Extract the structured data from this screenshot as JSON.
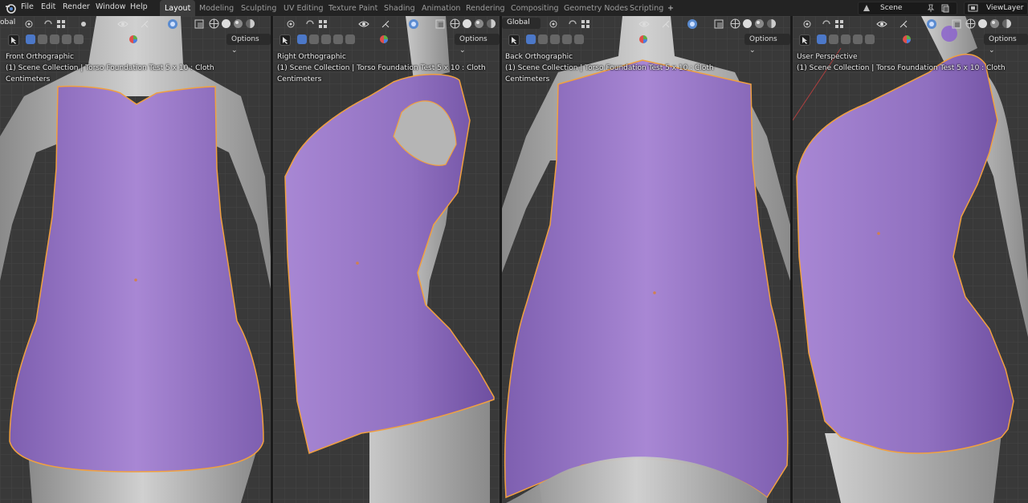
{
  "menu": {
    "file": "File",
    "edit": "Edit",
    "render": "Render",
    "window": "Window",
    "help": "Help"
  },
  "workspace_tabs": [
    "Layout",
    "Modeling",
    "Sculpting",
    "UV Editing",
    "Texture Paint",
    "Shading",
    "Animation",
    "Rendering",
    "Compositing",
    "Geometry Nodes",
    "Scripting"
  ],
  "add_tab": "+",
  "scene": {
    "label": "Scene"
  },
  "view_layer": {
    "label": "ViewLayer"
  },
  "viewports": [
    {
      "view": "Front Orthographic",
      "collection": "(1) Scene Collection | Torso Foundation Test 5 x 10 : Cloth",
      "units": "Centimeters",
      "options": "Options",
      "orientation": "obal"
    },
    {
      "view": "Right Orthographic",
      "collection": "(1) Scene Collection | Torso Foundation Test 5 x 10 : Cloth",
      "units": "Centimeters",
      "options": "Options"
    },
    {
      "view": "Back Orthographic",
      "collection": "(1) Scene Collection | Torso Foundation Test 5 x 10 : Cloth",
      "units": "Centimeters",
      "options": "Options",
      "orientation": "Global"
    },
    {
      "view": "User Perspective",
      "collection": "(1) Scene Collection | Torso Foundation Test 5 x 10 : Cloth",
      "units": "",
      "options": "Options"
    }
  ],
  "colors": {
    "cloth": "#9c7ac8",
    "cloth_shadow": "#7e5fb0",
    "outline": "#f0a040",
    "body": "#bdbdbd",
    "grid": "#3a3a3a",
    "active_tab": "#3d3d3d"
  }
}
